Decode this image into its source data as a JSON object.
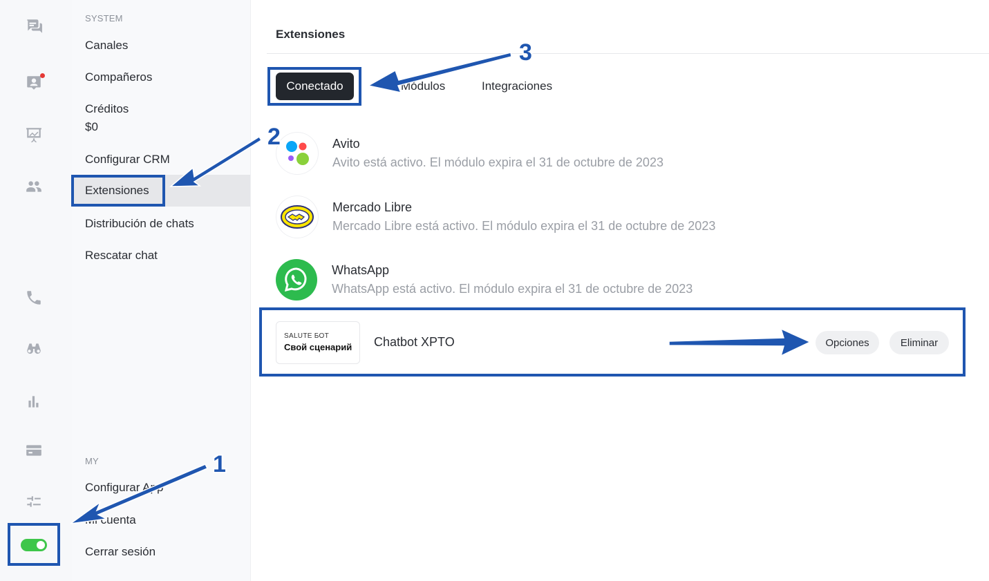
{
  "sidebar": {
    "section_system": "SYSTEM",
    "items": [
      {
        "label": "Canales"
      },
      {
        "label": "Compañeros"
      },
      {
        "label": "Créditos",
        "sub": "$0"
      },
      {
        "label": "Configurar CRM"
      },
      {
        "label": "Extensiones"
      },
      {
        "label": "Distribución de chats"
      },
      {
        "label": "Rescatar chat"
      }
    ],
    "section_my": "MY",
    "my_items": [
      {
        "label": "Configurar App"
      },
      {
        "label": "Mi cuenta"
      },
      {
        "label": "Cerrar sesión"
      }
    ]
  },
  "rail": {
    "icons": [
      "chat-bubbles-icon",
      "contact-card-icon",
      "presentation-chart-icon",
      "people-icon",
      "phone-icon",
      "binoculars-icon",
      "bar-chart-icon",
      "credit-card-icon",
      "sliders-icon",
      "toggle-icon"
    ],
    "toggle_on": true,
    "accent": "#3ec64a"
  },
  "main": {
    "title": "Extensiones",
    "tabs": [
      {
        "label": "Conectado",
        "active": true
      },
      {
        "label": "Módulos"
      },
      {
        "label": "Integraciones"
      }
    ],
    "extensions": [
      {
        "name": "Avito",
        "description": "Avito está activo. El módulo expira el 31 de octubre de 2023",
        "icon": "avito-logo"
      },
      {
        "name": "Mercado Libre",
        "description": "Mercado Libre está activo. El módulo expira el 31 de octubre de 2023",
        "icon": "mercadolibre-logo"
      },
      {
        "name": "WhatsApp",
        "description": "WhatsApp está activo. El módulo expira el 31 de octubre de 2023",
        "icon": "whatsapp-logo"
      }
    ],
    "chatbot": {
      "brand_line": "SALUTE БОТ",
      "brand_sub": "Свой сценарий",
      "name": "Chatbot XPTO",
      "options_label": "Opciones",
      "delete_label": "Eliminar"
    }
  },
  "annotations": {
    "callouts": [
      "1",
      "2",
      "3"
    ],
    "color": "#1f56b0"
  }
}
